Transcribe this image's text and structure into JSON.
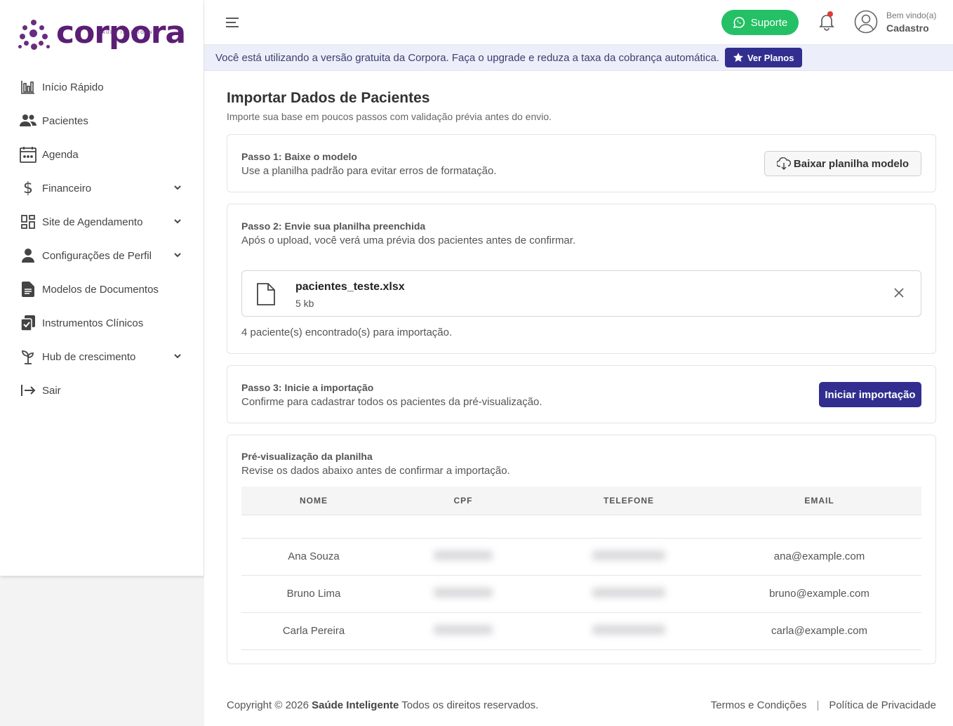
{
  "brand": {
    "name": "corpora",
    "tagline": "SAÚDE INTELIGENTE",
    "color": "#5b1e74"
  },
  "sidebar": {
    "items": [
      {
        "label": "Início Rápido",
        "icon": "bar-chart-icon"
      },
      {
        "label": "Pacientes",
        "icon": "users-icon"
      },
      {
        "label": "Agenda",
        "icon": "calendar-icon"
      },
      {
        "label": "Financeiro",
        "icon": "dollar-icon",
        "expandable": true
      },
      {
        "label": "Site de Agendamento",
        "icon": "dashboard-icon",
        "expandable": true
      },
      {
        "label": "Configurações de Perfil",
        "icon": "person-icon",
        "expandable": true
      },
      {
        "label": "Modelos de Documentos",
        "icon": "document-icon"
      },
      {
        "label": "Instrumentos Clínicos",
        "icon": "clipboard-check-icon"
      },
      {
        "label": "Hub de crescimento",
        "icon": "sprout-icon",
        "expandable": true
      },
      {
        "label": "Sair",
        "icon": "logout-icon"
      }
    ]
  },
  "header": {
    "support_label": "Suporte",
    "welcome": "Bem vindo(a)",
    "username": "Cadastro",
    "support_color": "#24c065"
  },
  "banner": {
    "text": "Você está utilizando a versão gratuita da Corpora. Faça o upgrade e reduza a taxa da cobrança automática.",
    "button_label": "Ver Planos"
  },
  "page": {
    "title": "Importar Dados de Pacientes",
    "subtitle": "Importe sua base em poucos passos com validação prévia antes do envio."
  },
  "step1": {
    "title": "Passo 1: Baixe o modelo",
    "subtitle": "Use a planilha padrão para evitar erros de formatação.",
    "button_label": "Baixar planilha modelo"
  },
  "step2": {
    "title": "Passo 2: Envie sua planilha preenchida",
    "subtitle": "Após o upload, você verá uma prévia dos pacientes antes de confirmar.",
    "file_name": "pacientes_teste.xlsx",
    "file_size": "5 kb",
    "found_text": "4 paciente(s) encontrado(s) para importação."
  },
  "step3": {
    "title": "Passo 3: Inicie a importação",
    "subtitle": "Confirme para cadastrar todos os pacientes da pré-visualização.",
    "button_label": "Iniciar importação",
    "button_color": "#312e8f"
  },
  "preview": {
    "title": "Pré-visualização da planilha",
    "subtitle": "Revise os dados abaixo antes de confirmar a importação.",
    "columns": [
      "NOME",
      "CPF",
      "TELEFONE",
      "EMAIL"
    ],
    "rows": [
      {
        "nome": "Ana Souza",
        "email": "ana@example.com"
      },
      {
        "nome": "Bruno Lima",
        "email": "bruno@example.com"
      },
      {
        "nome": "Carla Pereira",
        "email": "carla@example.com"
      }
    ]
  },
  "footer": {
    "copyright_prefix": "Copyright © 2026",
    "company": "Saúde Inteligente",
    "rights": "Todos os direitos reservados.",
    "terms": "Termos e Condições",
    "privacy": "Política de Privacidade"
  }
}
